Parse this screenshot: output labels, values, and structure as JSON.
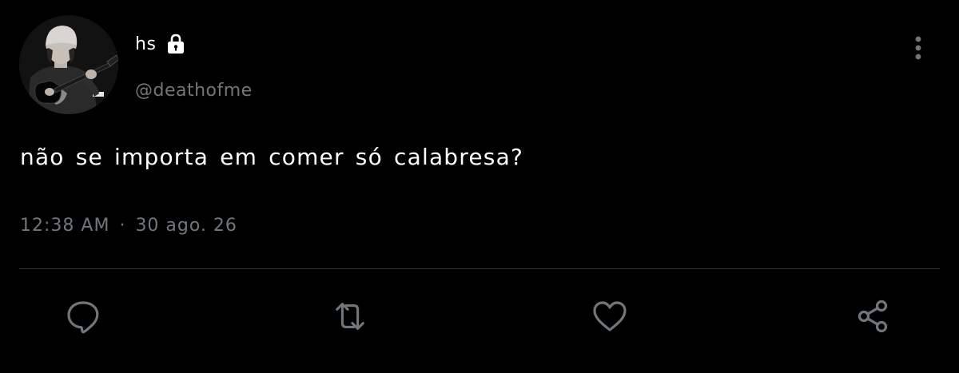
{
  "author": {
    "display_name": "hs",
    "handle": "@deathofme",
    "locked_icon": "lock-icon",
    "avatar": "profile photo of person with white beanie playing electric guitar"
  },
  "tweet": {
    "text": "não se importa em comer só calabresa?",
    "time": "12:38 AM",
    "separator": "·",
    "date": "30 ago. 26"
  },
  "actions": [
    {
      "icon": "reply-icon"
    },
    {
      "icon": "retweet-icon"
    },
    {
      "icon": "like-icon"
    },
    {
      "icon": "share-icon"
    }
  ],
  "menu": {
    "icon": "more-vertical-icon"
  },
  "colors": {
    "background": "#000000",
    "primary_text": "#ffffff",
    "secondary_text": "#71767b",
    "divider": "#2f3336",
    "icon": "#71767b"
  }
}
